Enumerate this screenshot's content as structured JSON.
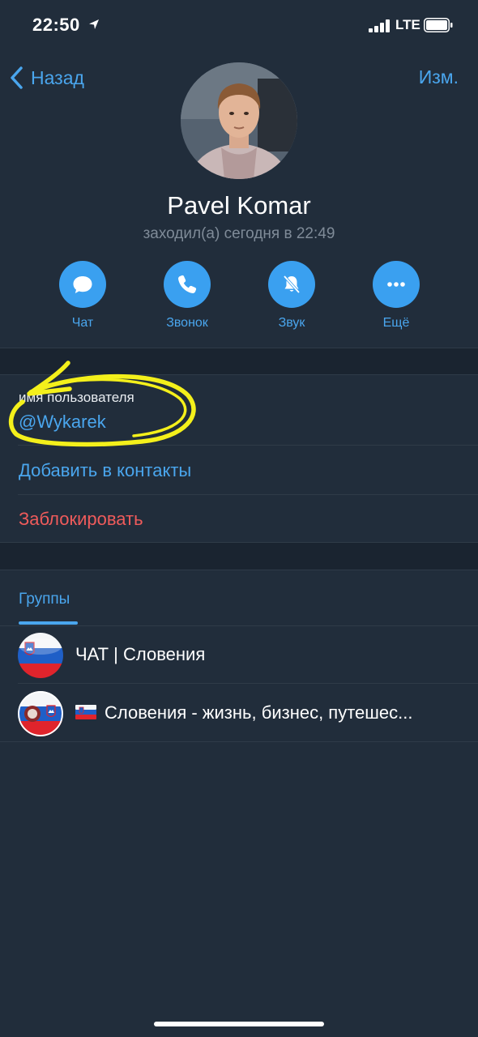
{
  "status_bar": {
    "time": "22:50",
    "network": "LTE"
  },
  "nav": {
    "back_label": "Назад",
    "edit_label": "Изм."
  },
  "profile": {
    "name": "Pavel Komar",
    "last_seen": "заходил(а) сегодня в 22:49"
  },
  "actions": [
    {
      "label": "Чат",
      "icon": "chat-bubble-icon"
    },
    {
      "label": "Звонок",
      "icon": "phone-icon"
    },
    {
      "label": "Звук",
      "icon": "bell-muted-icon"
    },
    {
      "label": "Ещё",
      "icon": "more-dots-icon"
    }
  ],
  "info": {
    "username_label": "имя пользователя",
    "username": "@Wykarek",
    "add_contact": "Добавить в контакты",
    "block": "Заблокировать"
  },
  "groups": {
    "tab_label": "Группы",
    "items": [
      {
        "name": "ЧАТ | Словения",
        "avatar": "slovenia-flag-ball"
      },
      {
        "name": "Словения - жизнь, бизнес, путешес...",
        "avatar": "slovenia-flag-ball-logo",
        "prefix_icon": "slovenia-flag-emoji"
      }
    ]
  },
  "colors": {
    "background": "#212d3b",
    "accent": "#4aa6ee",
    "danger": "#ef5b5b",
    "highlight_annotation": "#f4f01b"
  }
}
